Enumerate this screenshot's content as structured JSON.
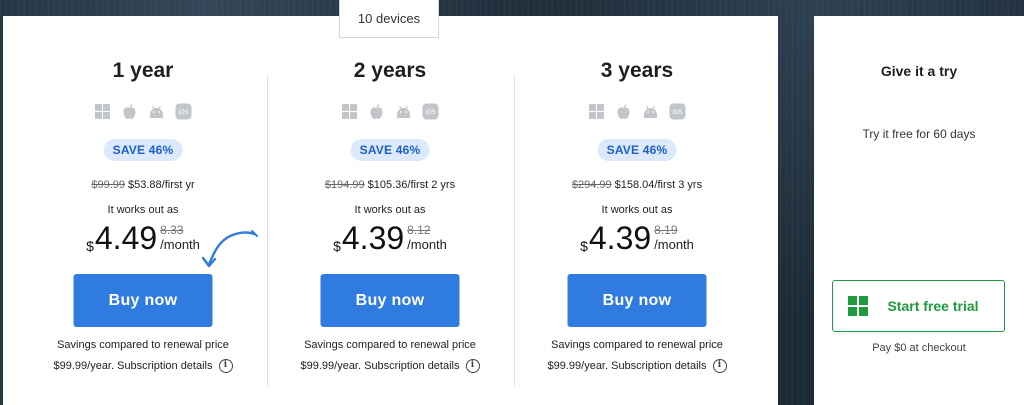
{
  "devices_tab": "10 devices",
  "plans": [
    {
      "title": "1 year",
      "save_badge": "SAVE 46%",
      "old_price": "$99.99",
      "new_price": "$53.88/first yr",
      "works_out": "It works out as",
      "currency": "$",
      "monthly_price": "4.49",
      "old_monthly": "8.33",
      "per": "/month",
      "buy_label": "Buy now",
      "savings_text": "Savings compared to renewal price",
      "renewal_text": "$99.99/year. Subscription details"
    },
    {
      "title": "2 years",
      "save_badge": "SAVE 46%",
      "old_price": "$194.99",
      "new_price": "$105.36/first 2 yrs",
      "works_out": "It works out as",
      "currency": "$",
      "monthly_price": "4.39",
      "old_monthly": "8.12",
      "per": "/month",
      "buy_label": "Buy now",
      "savings_text": "Savings compared to renewal price",
      "renewal_text": "$99.99/year. Subscription details"
    },
    {
      "title": "3 years",
      "save_badge": "SAVE 46%",
      "old_price": "$294.99",
      "new_price": "$158.04/first 3 yrs",
      "works_out": "It works out as",
      "currency": "$",
      "monthly_price": "4.39",
      "old_monthly": "8.19",
      "per": "/month",
      "buy_label": "Buy now",
      "savings_text": "Savings compared to renewal price",
      "renewal_text": "$99.99/year. Subscription details"
    }
  ],
  "os_icons": [
    "windows-icon",
    "apple-icon",
    "android-icon",
    "ios-icon"
  ],
  "ios_label": "iOS",
  "info_glyph": "i",
  "trial": {
    "title": "Give it a try",
    "subtitle": "Try it free for 60 days",
    "button_label": "Start free trial",
    "pay_note": "Pay $0 at checkout"
  },
  "colors": {
    "buy_button": "#2f7be0",
    "badge_bg": "#dce9fb",
    "badge_text": "#1b5fc7",
    "trial_green": "#1f9a3e",
    "background": "#1c2a36"
  }
}
